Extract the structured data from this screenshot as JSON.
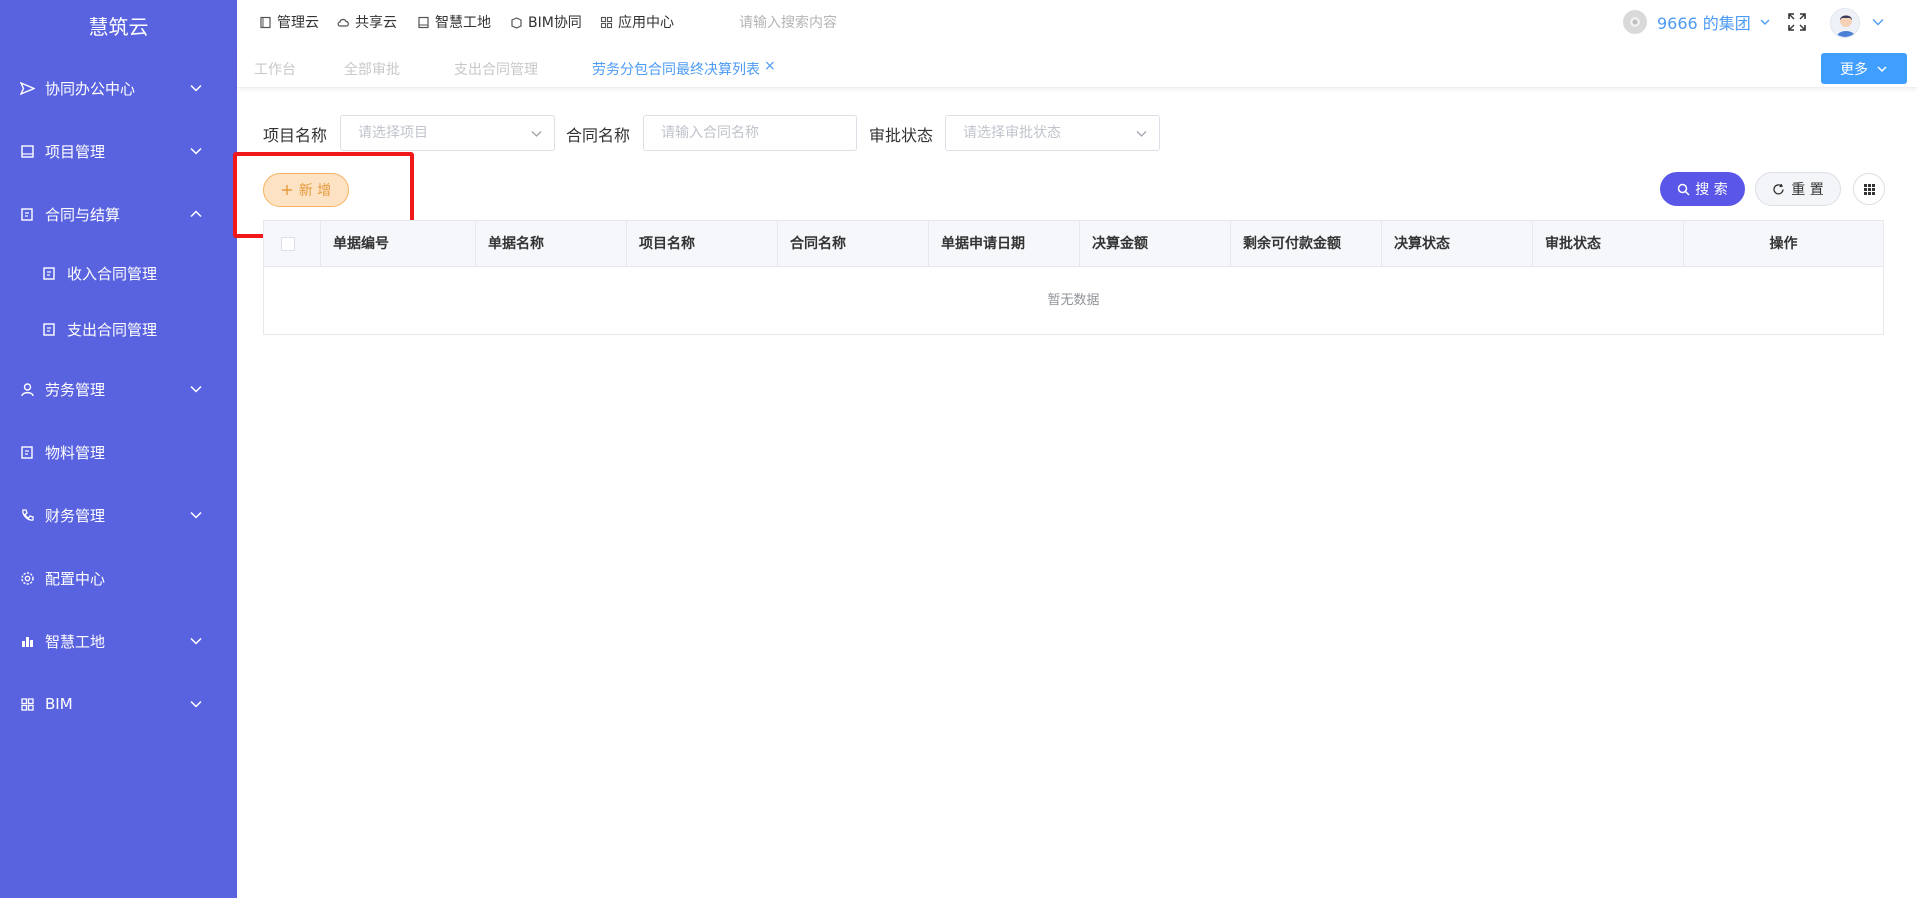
{
  "brand": "慧筑云",
  "sidebar": {
    "items": [
      {
        "label": "协同办公中心",
        "icon": "send-icon",
        "expanded": false
      },
      {
        "label": "项目管理",
        "icon": "book-icon",
        "expanded": false
      },
      {
        "label": "合同与结算",
        "icon": "edit-icon",
        "expanded": true
      },
      {
        "label": "收入合同管理",
        "icon": "edit-icon"
      },
      {
        "label": "支出合同管理",
        "icon": "edit-icon"
      },
      {
        "label": "劳务管理",
        "icon": "user-icon",
        "expanded": false
      },
      {
        "label": "物料管理",
        "icon": "edit-icon"
      },
      {
        "label": "财务管理",
        "icon": "phone-icon",
        "expanded": false
      },
      {
        "label": "配置中心",
        "icon": "gear-icon"
      },
      {
        "label": "智慧工地",
        "icon": "bar-chart-icon",
        "expanded": false
      },
      {
        "label": "BIM",
        "icon": "grid-icon",
        "expanded": false
      }
    ]
  },
  "topnav": {
    "items": [
      {
        "label": "管理云",
        "icon": "book-icon"
      },
      {
        "label": "共享云",
        "icon": "cloud-icon"
      },
      {
        "label": "智慧工地",
        "icon": "book-icon"
      },
      {
        "label": "BIM协同",
        "icon": "cube-icon"
      },
      {
        "label": "应用中心",
        "icon": "grid-icon"
      }
    ],
    "search_placeholder": "请输入搜索内容",
    "org_name": "9666 的集团"
  },
  "tabs": {
    "items": [
      "工作台",
      "全部审批",
      "支出合同管理",
      "劳务分包合同最终决算列表"
    ],
    "active_index": 3,
    "close_symbol": "×",
    "more_label": "更多"
  },
  "filters": {
    "project_label": "项目名称",
    "project_placeholder": "请选择项目",
    "contract_label": "合同名称",
    "contract_placeholder": "请输入合同名称",
    "status_label": "审批状态",
    "status_placeholder": "请选择审批状态"
  },
  "actions": {
    "add_label": "新 增",
    "search_label": "搜 索",
    "reset_label": "重 置"
  },
  "table": {
    "columns": [
      "单据编号",
      "单据名称",
      "项目名称",
      "合同名称",
      "单据申请日期",
      "决算金额",
      "剩余可付款金额",
      "决算状态",
      "审批状态",
      "操作"
    ],
    "empty_text": "暂无数据"
  },
  "colors": {
    "sidebar_bg": "#5a63df",
    "accent_blue": "#4c9bf5",
    "search_button": "#5a57e8",
    "add_button_bg": "#fde3c3",
    "highlight_red": "#f01818"
  }
}
